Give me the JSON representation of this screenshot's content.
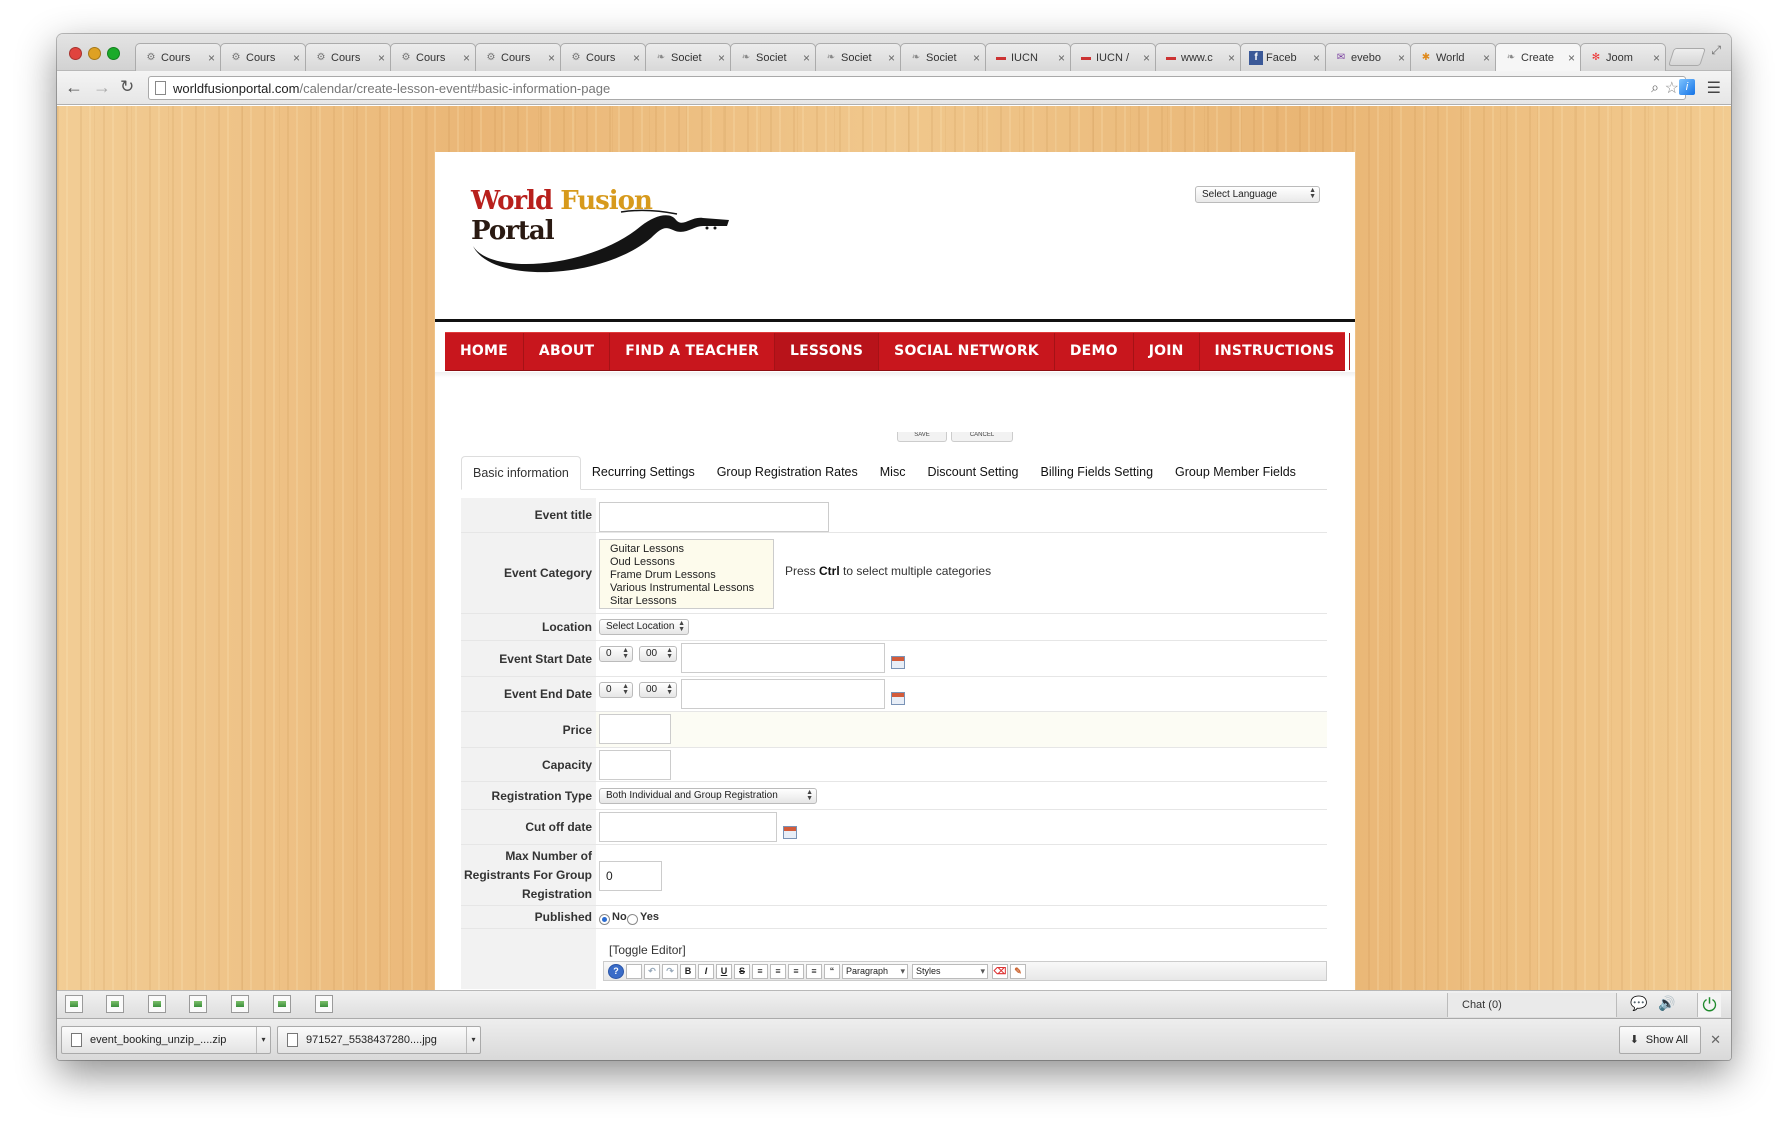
{
  "browser": {
    "tabs": [
      {
        "title": "Cours",
        "icon": "gear-icon",
        "active": false
      },
      {
        "title": "Cours",
        "icon": "gear-icon",
        "active": false
      },
      {
        "title": "Cours",
        "icon": "gear-icon",
        "active": false
      },
      {
        "title": "Cours",
        "icon": "gear-icon",
        "active": false
      },
      {
        "title": "Cours",
        "icon": "gear-icon",
        "active": false
      },
      {
        "title": "Cours",
        "icon": "gear-icon",
        "active": false
      },
      {
        "title": "Societ",
        "icon": "leaf-icon",
        "active": false
      },
      {
        "title": "Societ",
        "icon": "leaf-icon",
        "active": false
      },
      {
        "title": "Societ",
        "icon": "leaf-icon",
        "active": false
      },
      {
        "title": "Societ",
        "icon": "leaf-icon",
        "active": false
      },
      {
        "title": "IUCN",
        "icon": "flag-icon",
        "active": false
      },
      {
        "title": "IUCN /",
        "icon": "flag-icon",
        "active": false
      },
      {
        "title": "www.c",
        "icon": "flag-icon",
        "active": false
      },
      {
        "title": "Faceb",
        "icon": "facebook-icon",
        "active": false
      },
      {
        "title": "evebo",
        "icon": "mail-icon",
        "active": false
      },
      {
        "title": "World",
        "icon": "puzzle-icon",
        "active": false
      },
      {
        "title": "Create",
        "icon": "leaf-icon",
        "active": true
      },
      {
        "title": "Joom",
        "icon": "joomla-icon",
        "active": false
      }
    ],
    "url_host": "worldfusionportal.com",
    "url_path": "/calendar/create-lesson-event#basic-information-page"
  },
  "site": {
    "logo_word1": "World",
    "logo_word2": "Fusion",
    "logo_word3": "Portal",
    "language_select": "Select Language"
  },
  "nav": [
    {
      "label": "HOME",
      "active": false
    },
    {
      "label": "ABOUT",
      "active": false
    },
    {
      "label": "FIND A TEACHER",
      "active": false
    },
    {
      "label": "LESSONS",
      "active": true
    },
    {
      "label": "SOCIAL NETWORK",
      "active": false
    },
    {
      "label": "DEMO",
      "active": false
    },
    {
      "label": "JOIN",
      "active": false
    },
    {
      "label": "INSTRUCTIONS",
      "active": false
    }
  ],
  "form_buttons": {
    "save": "SAVE",
    "cancel": "CANCEL"
  },
  "subtabs": [
    {
      "label": "Basic information",
      "active": true
    },
    {
      "label": "Recurring Settings",
      "active": false
    },
    {
      "label": "Group Registration Rates",
      "active": false
    },
    {
      "label": "Misc",
      "active": false
    },
    {
      "label": "Discount Setting",
      "active": false
    },
    {
      "label": "Billing Fields Setting",
      "active": false
    },
    {
      "label": "Group Member Fields",
      "active": false
    }
  ],
  "form": {
    "event_title_label": "Event title",
    "event_title_value": "",
    "event_category_label": "Event Category",
    "categories": [
      "Guitar Lessons",
      "Oud Lessons",
      "Frame Drum Lessons",
      "Various Instrumental Lessons",
      "Sitar Lessons"
    ],
    "category_hint_pre": "Press ",
    "category_hint_key": "Ctrl",
    "category_hint_post": " to select multiple categories",
    "location_label": "Location",
    "location_value": "Select Location",
    "start_date_label": "Event Start Date",
    "start_hour": "0",
    "start_minute": "00",
    "end_date_label": "Event End Date",
    "end_hour": "0",
    "end_minute": "00",
    "price_label": "Price",
    "capacity_label": "Capacity",
    "registration_type_label": "Registration Type",
    "registration_type_value": "Both Individual and Group Registration",
    "cutoff_label": "Cut off date",
    "max_registrants_label_1": "Max Number of",
    "max_registrants_label_2": "Registrants For Group",
    "max_registrants_label_3": "Registration",
    "max_registrants_value": "0",
    "published_label": "Published",
    "published_no": "No",
    "published_yes": "Yes",
    "toggle_editor": "[Toggle Editor]",
    "editor_format": "Paragraph",
    "editor_styles": "Styles"
  },
  "chatbar": {
    "chat_label": "Chat (0)"
  },
  "downloads": {
    "items": [
      "event_booking_unzip_....zip",
      "971527_5538437280....jpg"
    ],
    "show_all": "Show All"
  }
}
